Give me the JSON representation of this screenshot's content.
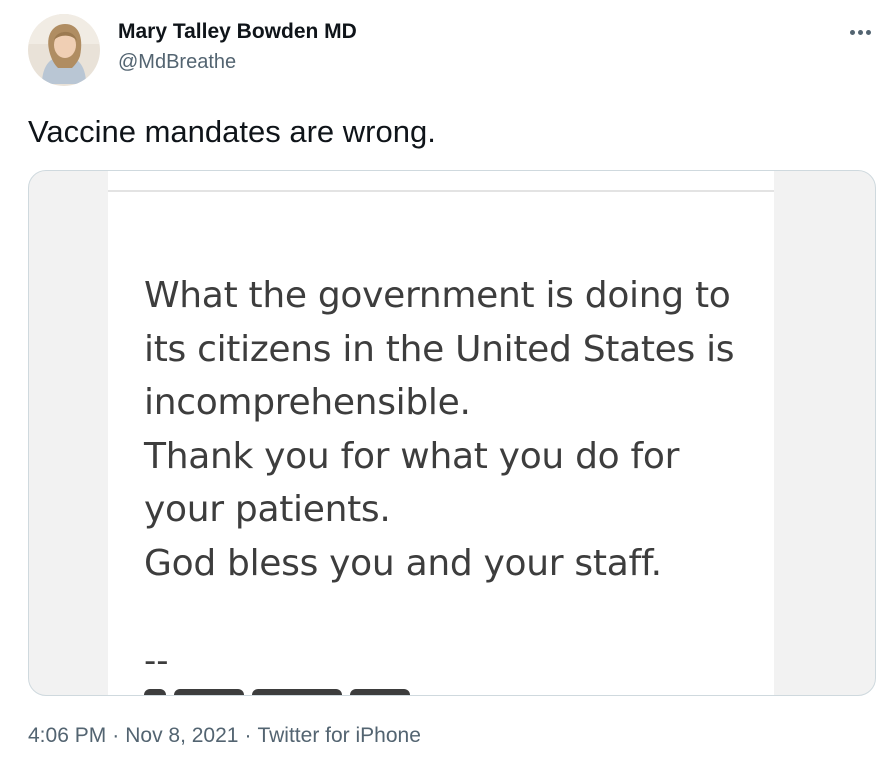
{
  "author": {
    "name": "Mary Talley Bowden MD",
    "handle": "@MdBreathe",
    "avatar_icon": "profile-photo"
  },
  "more_icon": "more-dots-icon",
  "tweet": {
    "text": "Vaccine mandates are wrong."
  },
  "media": {
    "lines": [
      "What the government is doing to",
      "its citizens in the United States is",
      "incomprehensible.",
      "Thank you for what you do for",
      "your patients.",
      "God bless you and your staff."
    ],
    "signature_dash": "--"
  },
  "meta": {
    "time": "4:06 PM",
    "separator": "·",
    "date": "Nov 8, 2021",
    "source": "Twitter for iPhone"
  },
  "colors": {
    "text_primary": "#0f1419",
    "text_secondary": "#536471",
    "media_border": "#cfd9de",
    "media_text": "#3d3d3d"
  }
}
